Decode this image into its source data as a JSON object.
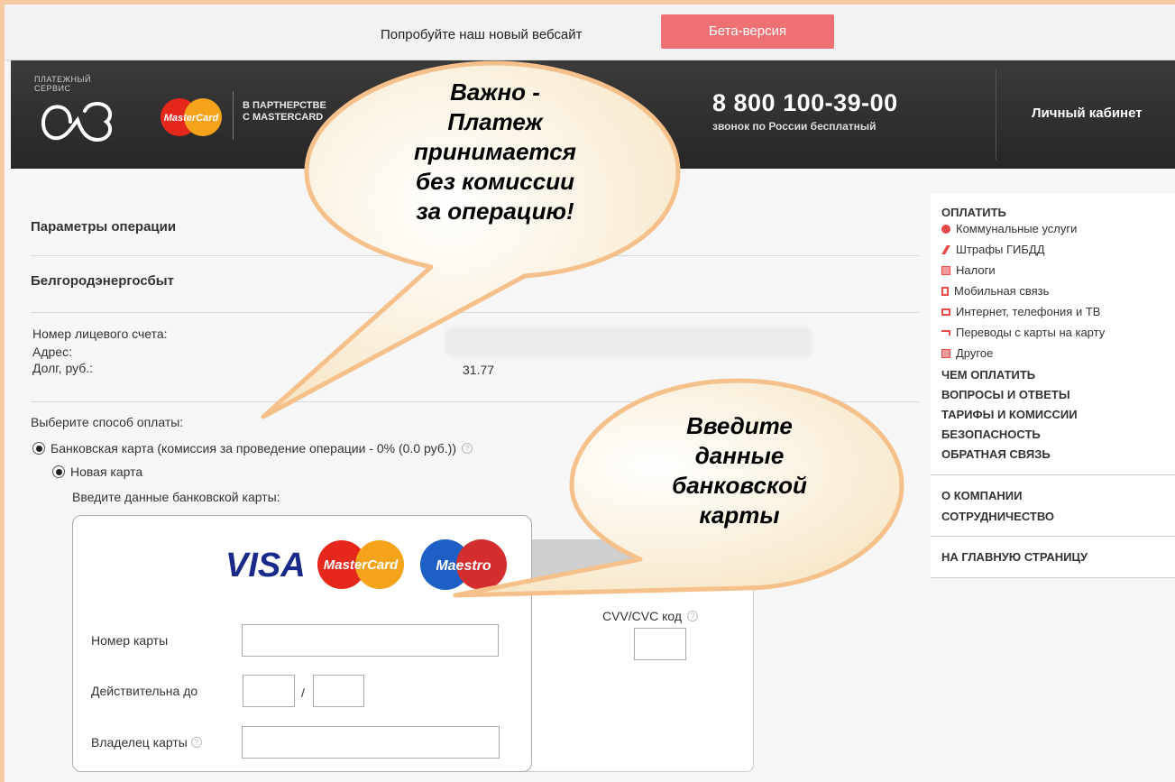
{
  "promo": {
    "text": "Попробуйте наш новый вебсайт",
    "beta_label": "Бета-версия",
    "beta_color": "#ef7173"
  },
  "header": {
    "logo_small_line1": "ПЛАТЕЖНЫЙ",
    "logo_small_line2": "СЕРВИС",
    "logo_mark_icon": "a3-logo-icon",
    "mastercard_logo": "MasterCard",
    "partner_line1": "В ПАРТНЕРСТВЕ",
    "partner_line2": "С MASTERCARD",
    "phone": "8 800 100-39-00",
    "phone_sub": "звонок по России бесплатный",
    "account_link": "Личный кабинет"
  },
  "main": {
    "params_title": "Параметры операции",
    "provider_title": "Белгородэнергосбыт",
    "info": {
      "account_label": "Номер лицевого счета:",
      "address_label": "Адрес:",
      "debt_label": "Долг, руб.:",
      "debt_value": "31.77"
    },
    "choose_method": "Выберите способ оплаты:",
    "bank_card_option": "Банковская карта (комиссия за проведение операции - 0% (0.0 руб.))",
    "new_card_option": "Новая карта",
    "enter_card_data": "Введите данные банковской карты:"
  },
  "card_form": {
    "brands": [
      "VISA",
      "MasterCard",
      "Maestro"
    ],
    "card_number_label": "Номер карты",
    "card_number_value": "",
    "valid_until_label": "Действительна до",
    "month_value": "",
    "year_value": "",
    "separator": "/",
    "holder_label": "Владелец карты",
    "holder_value": "",
    "cvv_label": "CVV/CVC код",
    "cvv_value": ""
  },
  "sidebar": {
    "pay_heading": "ОПЛАТИТЬ",
    "pay_items": [
      {
        "label": "Коммунальные услуги",
        "icon": "utilities-icon",
        "color": "#e84a4a"
      },
      {
        "label": "Штрафы ГИБДД",
        "icon": "pen-icon",
        "color": "#e84a4a"
      },
      {
        "label": "Налоги",
        "icon": "tax-icon",
        "color": "#e84a4a"
      },
      {
        "label": "Мобильная связь",
        "icon": "mobile-icon",
        "color": "#e84a4a"
      },
      {
        "label": "Интернет, телефония и ТВ",
        "icon": "tv-icon",
        "color": "#e84a4a"
      },
      {
        "label": "Переводы с карты на карту",
        "icon": "transfer-icon",
        "color": "#e84a4a"
      },
      {
        "label": "Другое",
        "icon": "other-icon",
        "color": "#e84a4a"
      }
    ],
    "links_group1": [
      "ЧЕМ ОПЛАТИТЬ",
      "ВОПРОСЫ И ОТВЕТЫ",
      "ТАРИФЫ И КОМИССИИ",
      "БЕЗОПАСНОСТЬ",
      "ОБРАТНАЯ СВЯЗЬ"
    ],
    "links_group2": [
      "О КОМПАНИИ",
      "СОТРУДНИЧЕСТВО"
    ],
    "home_link": "НА ГЛАВНУЮ СТРАНИЦУ"
  },
  "callouts": {
    "bubble1_lines": [
      "Важно -",
      "Платеж",
      "принимается",
      "без комиссии",
      "за операцию!"
    ],
    "bubble2_lines": [
      "Введите",
      "данные",
      "банковской",
      "карты"
    ],
    "bubble_fill": "#fdf3e0",
    "bubble_stroke": "#f5c08a"
  }
}
